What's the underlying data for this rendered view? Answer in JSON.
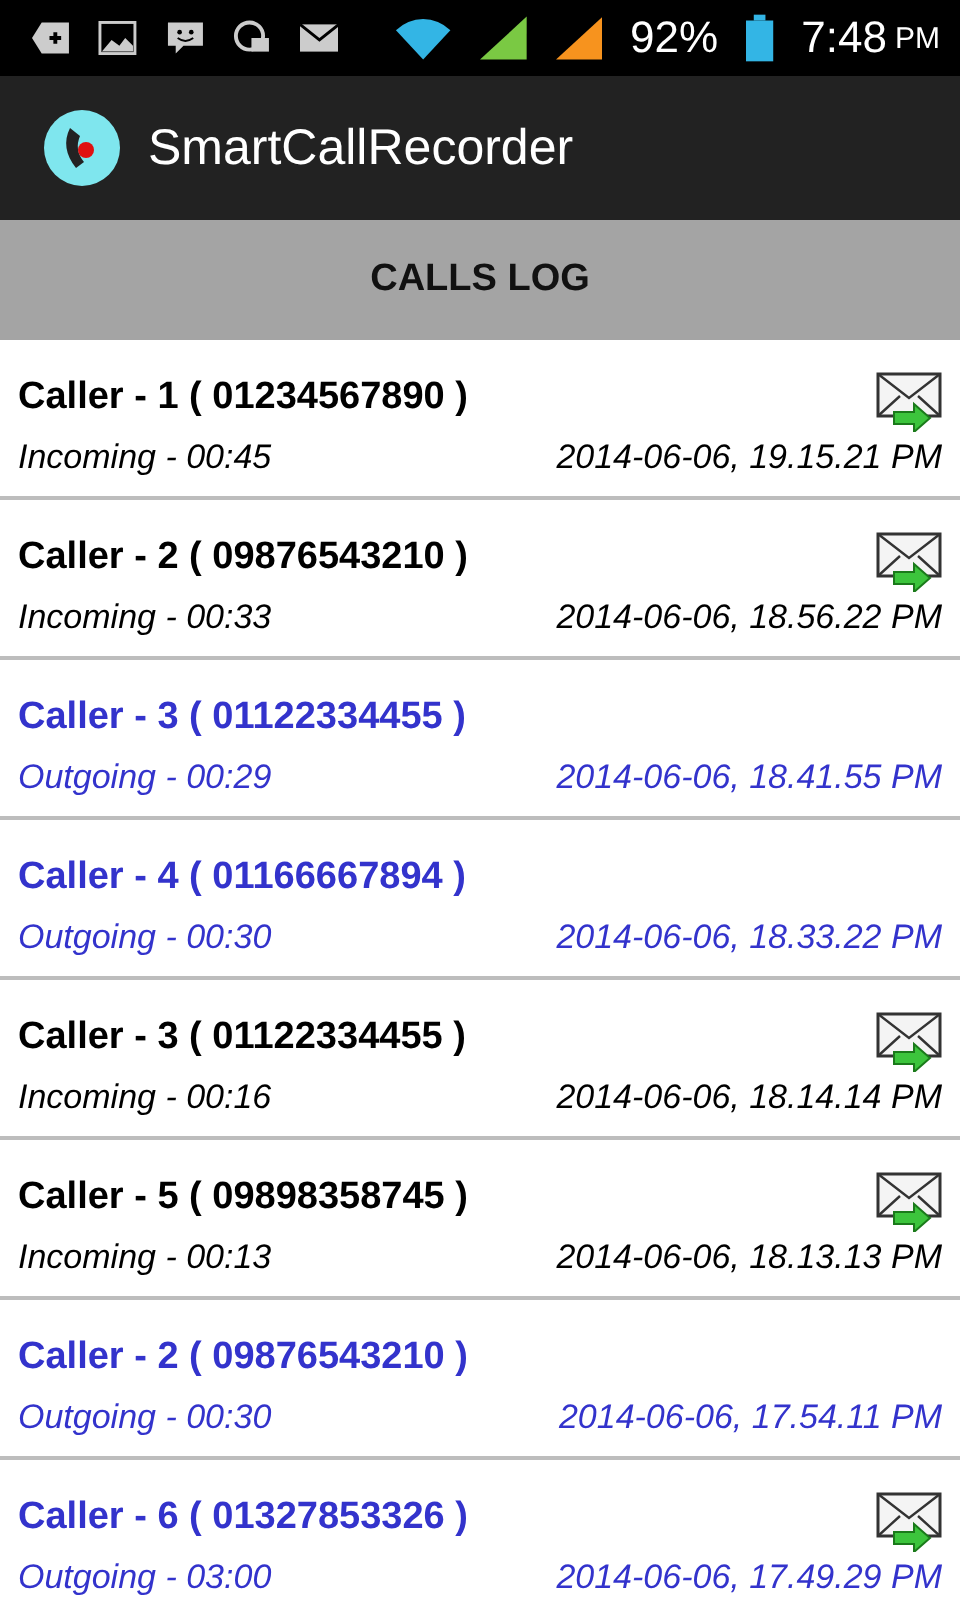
{
  "status_bar": {
    "battery": "92%",
    "time": "7:48",
    "ampm": "PM"
  },
  "app_bar": {
    "title": "SmartCallRecorder"
  },
  "header": {
    "title": "CALLS LOG"
  },
  "calls": [
    {
      "caller": "Caller - 1 ( 01234567890 )",
      "kind": "incoming",
      "info": "Incoming - 00:45",
      "date": "2014-06-06, 19.15.21 PM",
      "sent": true
    },
    {
      "caller": "Caller - 2 ( 09876543210 )",
      "kind": "incoming",
      "info": "Incoming - 00:33",
      "date": "2014-06-06, 18.56.22 PM",
      "sent": true
    },
    {
      "caller": "Caller - 3 ( 01122334455 )",
      "kind": "outgoing",
      "info": "Outgoing - 00:29",
      "date": "2014-06-06, 18.41.55 PM",
      "sent": false
    },
    {
      "caller": "Caller - 4 ( 01166667894 )",
      "kind": "outgoing",
      "info": "Outgoing - 00:30",
      "date": "2014-06-06, 18.33.22 PM",
      "sent": false
    },
    {
      "caller": "Caller - 3 ( 01122334455 )",
      "kind": "incoming",
      "info": "Incoming - 00:16",
      "date": "2014-06-06, 18.14.14 PM",
      "sent": true
    },
    {
      "caller": "Caller - 5 ( 09898358745 )",
      "kind": "incoming",
      "info": "Incoming - 00:13",
      "date": "2014-06-06, 18.13.13 PM",
      "sent": true
    },
    {
      "caller": "Caller - 2 ( 09876543210 )",
      "kind": "outgoing",
      "info": "Outgoing - 00:30",
      "date": "2014-06-06, 17.54.11 PM",
      "sent": false
    },
    {
      "caller": "Caller - 6 ( 01327853326 )",
      "kind": "outgoing",
      "info": "Outgoing - 03:00",
      "date": "2014-06-06, 17.49.29 PM",
      "sent": true
    }
  ]
}
